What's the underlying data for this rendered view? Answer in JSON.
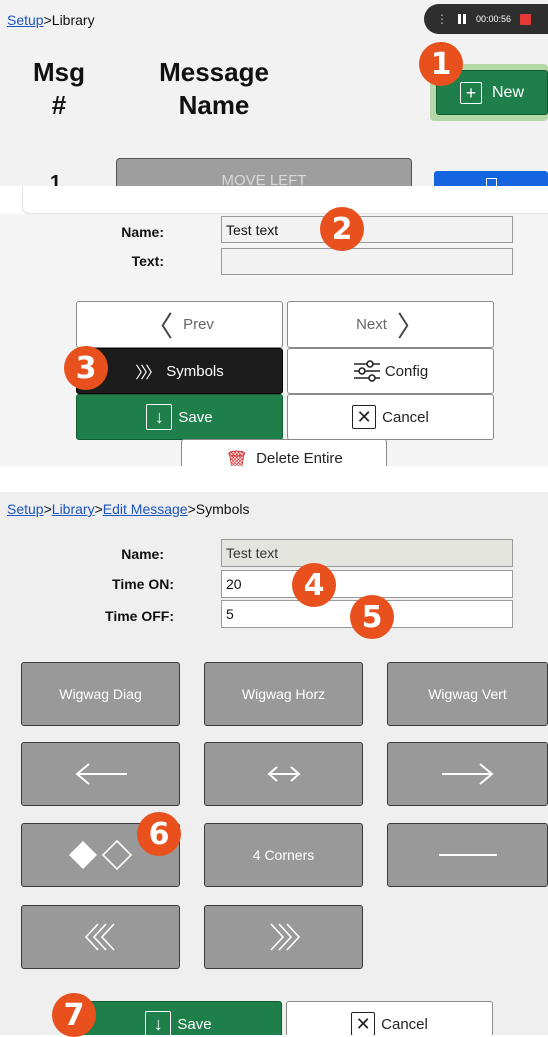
{
  "panel1": {
    "breadcrumb": {
      "setup": "Setup",
      "sep": ">",
      "current": "Library"
    },
    "recorder": {
      "time": "00:00:56"
    },
    "headers": {
      "msg_num": "Msg\n#",
      "message_name": "Message\nName"
    },
    "new_button": "New",
    "row_number": "1",
    "row_button": "MOVE LEFT"
  },
  "panel2": {
    "name_label": "Name:",
    "name_value": "Test text",
    "text_label": "Text:",
    "text_value": "",
    "prev": "Prev",
    "next": "Next",
    "symbols": "Symbols",
    "config": "Config",
    "save": "Save",
    "cancel": "Cancel",
    "delete": "Delete Entire"
  },
  "panel3": {
    "breadcrumb": {
      "setup": "Setup",
      "library": "Library",
      "edit": "Edit Message",
      "current": "Symbols",
      "sep": ">"
    },
    "name_label": "Name:",
    "name_value": "Test text",
    "time_on_label": "Time ON:",
    "time_on_value": "20",
    "time_off_label": "Time OFF:",
    "time_off_value": "5",
    "symbols": {
      "wigwag_diag": "Wigwag Diag",
      "wigwag_horz": "Wigwag Horz",
      "wigwag_vert": "Wigwag Vert",
      "four_corners": "4 Corners"
    },
    "save": "Save",
    "cancel": "Cancel"
  },
  "badges": [
    "1",
    "2",
    "3",
    "4",
    "5",
    "6",
    "7"
  ],
  "colors": {
    "badge": "#e8501e",
    "green": "#1e7f4a",
    "link": "#1a55c0",
    "record": "#e53935"
  }
}
